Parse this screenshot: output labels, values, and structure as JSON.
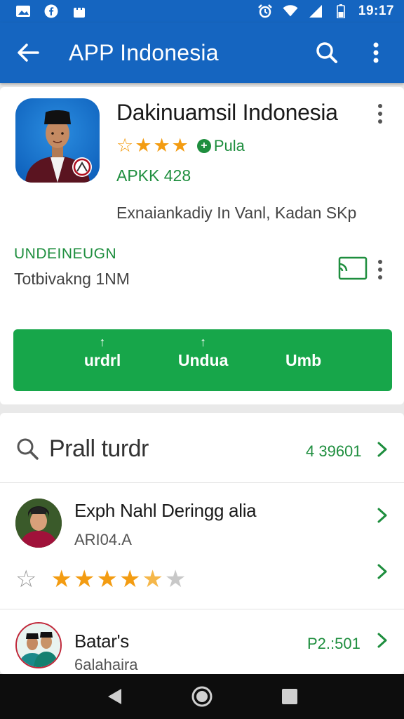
{
  "status_bar": {
    "time": "19:17",
    "left_icons": [
      "gallery-icon",
      "fb-icon",
      "bag-icon"
    ],
    "right_icons": [
      "alarm-icon",
      "wifi-icon",
      "signal-icon",
      "battery-icon"
    ]
  },
  "app_bar": {
    "title": "APP Indonesia",
    "color": "#1565c0"
  },
  "app": {
    "name": "Dakinuamsil Indonesia",
    "rating_badge": "Pula",
    "version": "APKK 428",
    "description": "Exnaiankadiy In Vanl, Kadan SKp",
    "developer_label": "UNDEINEUGN",
    "developer_sub": "Totbivakng 1NM",
    "stars_filled": 3,
    "stars_total": 4
  },
  "install_button": {
    "segments": [
      "urdrl",
      "Undua",
      "Umb"
    ],
    "color": "#17a64a"
  },
  "search_section": {
    "title": "Prall turdr",
    "count": "4 39601"
  },
  "items": [
    {
      "title": "Exph Nahl Deringg alia",
      "sub": "ARI04.A",
      "rating": 4.5
    },
    {
      "title": "Batar's",
      "sub": "6alahaira",
      "price": "P2.:501"
    }
  ],
  "colors": {
    "accent": "#1565c0",
    "green": "#1e8e3e",
    "star": "#f39c12"
  }
}
